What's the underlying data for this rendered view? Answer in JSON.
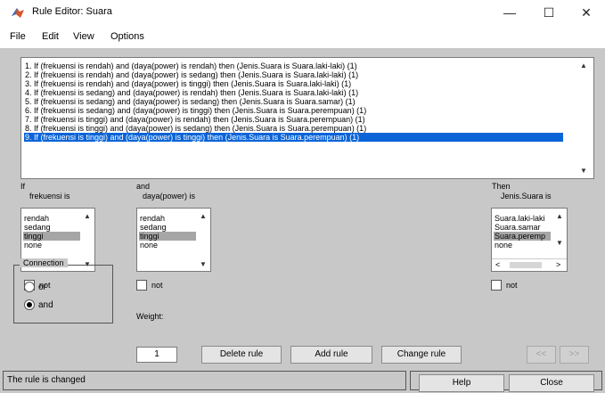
{
  "window": {
    "title": "Rule Editor: Suara",
    "minimize": "—",
    "maximize": "☐",
    "close": "✕"
  },
  "menu": [
    "File",
    "Edit",
    "View",
    "Options"
  ],
  "rules": [
    "1. If (frekuensi is rendah) and (daya(power) is rendah) then (Jenis.Suara is Suara.laki-laki) (1)",
    "2. If (frekuensi is rendah) and (daya(power) is sedang) then (Jenis.Suara is Suara.laki-laki) (1)",
    "3. If (frekuensi is rendah) and (daya(power) is tinggi) then (Jenis.Suara is Suara.laki-laki) (1)",
    "4. If (frekuensi is sedang) and (daya(power) is rendah) then (Jenis.Suara is Suara.laki-laki) (1)",
    "5. If (frekuensi is sedang) and (daya(power) is sedang) then (Jenis.Suara is Suara.samar) (1)",
    "6. If (frekuensi is sedang) and (daya(power) is tinggi) then (Jenis.Suara is Suara.perempuan) (1)",
    "7. If (frekuensi is tinggi) and (daya(power) is rendah) then (Jenis.Suara is Suara.perempuan) (1)",
    "8. If (frekuensi is tinggi) and (daya(power) is sedang) then (Jenis.Suara is Suara.perempuan) (1)",
    "9. If (frekuensi is tinggi) and (daya(power) is tinggi) then (Jenis.Suara is Suara.perempuan) (1)"
  ],
  "selected_rule_index": 8,
  "if_section": {
    "label": "If",
    "var_label": "frekuensi is",
    "options": [
      "rendah",
      "sedang",
      "tinggi",
      "none"
    ],
    "selected": "tinggi",
    "not_label": "not"
  },
  "and_section": {
    "label": "and",
    "var_label": "daya(power) is",
    "options": [
      "rendah",
      "sedang",
      "tinggi",
      "none"
    ],
    "selected": "tinggi",
    "not_label": "not"
  },
  "then_section": {
    "label": "Then",
    "var_label": "Jenis.Suara is",
    "options": [
      "Suara.laki-laki",
      "Suara.samar",
      "Suara.peremp",
      "none"
    ],
    "selected": "Suara.peremp",
    "not_label": "not"
  },
  "connection": {
    "title": "Connection",
    "options": [
      "or",
      "and"
    ],
    "selected": "and"
  },
  "weight": {
    "label": "Weight:",
    "value": "1"
  },
  "buttons": {
    "delete": "Delete rule",
    "add": "Add rule",
    "change": "Change rule",
    "prev": "<<",
    "next": ">>",
    "help": "Help",
    "close": "Close"
  },
  "status": "The rule is changed",
  "colors": {
    "selection": "#0a64d8",
    "panel": "#c8c8c8",
    "list_selection": "#a6a6a6"
  }
}
